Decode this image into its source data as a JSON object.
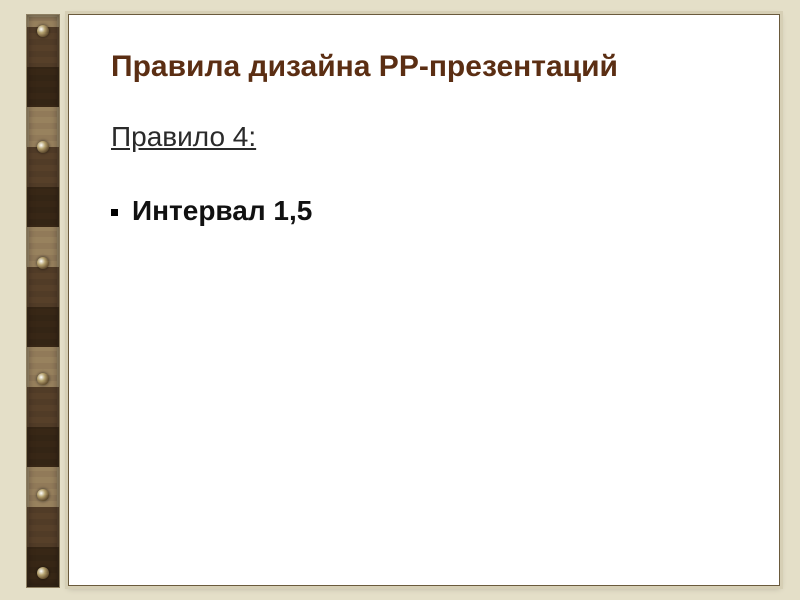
{
  "slide": {
    "title": "Правила дизайна PP-презентаций",
    "subtitle": "Правило 4:",
    "bullet": "Интервал 1,5"
  }
}
